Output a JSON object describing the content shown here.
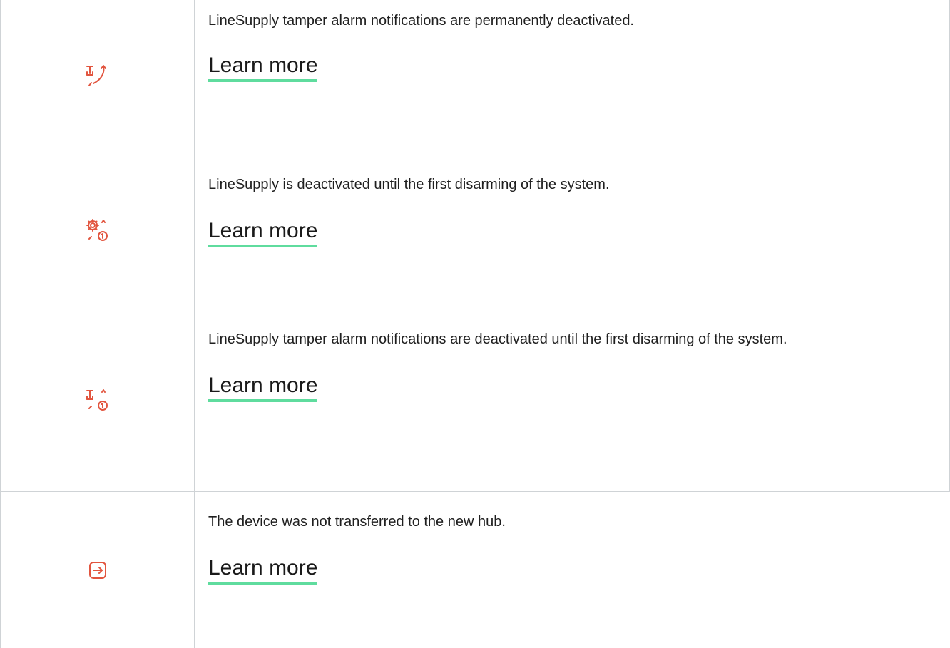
{
  "rows": [
    {
      "icon": "tamper-alarm-off-icon",
      "description": "LineSupply tamper alarm notifications are permanently deactivated.",
      "link_label": "Learn more"
    },
    {
      "icon": "gear-one-time-off-icon",
      "description": "LineSupply is deactivated until the first disarming of the system.",
      "link_label": "Learn more"
    },
    {
      "icon": "tamper-one-time-off-icon",
      "description": "LineSupply tamper alarm notifications are deactivated until the first disarming of the system.",
      "link_label": "Learn more"
    },
    {
      "icon": "transfer-arrow-icon",
      "description": "The device was not transferred to the new hub.",
      "link_label": "Learn more"
    }
  ],
  "colors": {
    "icon": "#e2553f",
    "link_underline": "#5fdc9e",
    "border": "#cfd3d6",
    "text": "#1f1f1f"
  }
}
